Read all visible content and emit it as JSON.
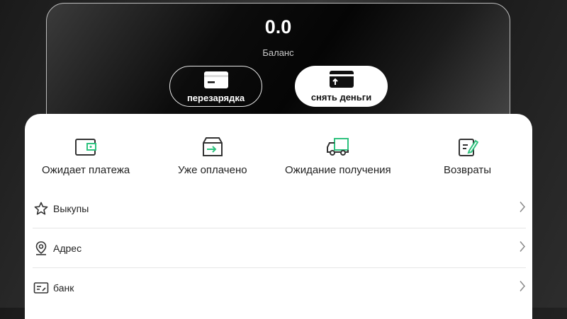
{
  "balance": {
    "value": "0.0",
    "label": "Баланс"
  },
  "actions": {
    "recharge_label": "перезарядка",
    "withdraw_label": "снять деньги"
  },
  "orders": [
    {
      "label": "Ожидает платежа",
      "icon": "wallet-icon"
    },
    {
      "label": "Уже оплачено",
      "icon": "paid-box-icon"
    },
    {
      "label": "Ожидание получения",
      "icon": "delivery-truck-icon"
    },
    {
      "label": "Возвраты",
      "icon": "return-edit-icon"
    }
  ],
  "menu": [
    {
      "label": "Выкупы",
      "icon": "star-icon"
    },
    {
      "label": "Адрес",
      "icon": "location-pin-icon"
    },
    {
      "label": "банк",
      "icon": "bank-card-icon"
    }
  ],
  "colors": {
    "accent": "#2ec27e",
    "icon_dark": "#333333"
  }
}
